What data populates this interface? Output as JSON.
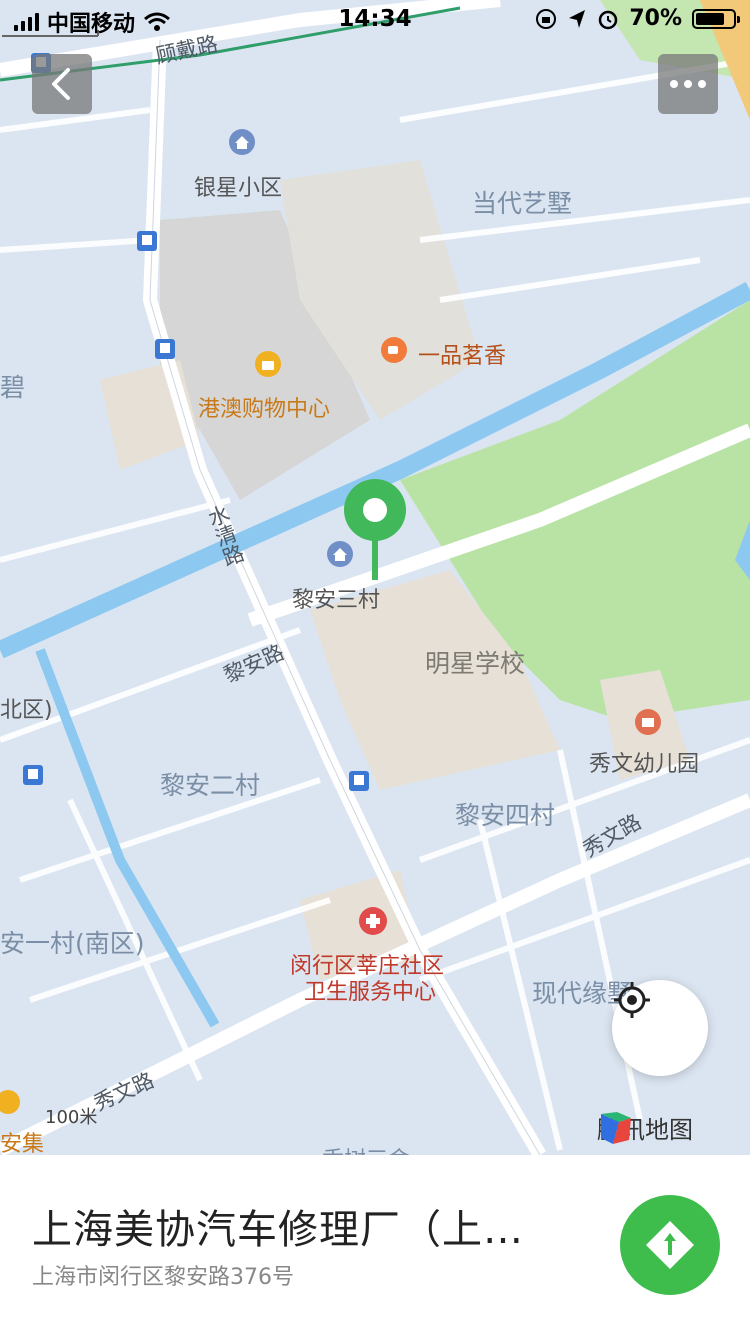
{
  "status": {
    "carrier": "中国移动",
    "time": "14:34",
    "battery": "70%",
    "battery_level": 0.7
  },
  "map": {
    "labels": {
      "gudai_road": "顾戴路",
      "yinxing": "银星小区",
      "dangdai": "当代艺墅",
      "yipin": "一品茗香",
      "gangao": "港澳购物中心",
      "shuiqing": "水清路",
      "lian3": "黎安三村",
      "lian_road": "黎安路",
      "mingxing": "明星学校",
      "bei": "北区)",
      "xiuwen_kg": "秀文幼儿园",
      "lian2": "黎安二村",
      "lian4": "黎安四村",
      "xiuwen_road_right": "秀文路",
      "lian1_south": "安一村(南区)",
      "hospital_1": "闵行区莘庄社区",
      "hospital_2": "卫生服务中心",
      "xiandai": "现代缘墅",
      "xiuwen_road_left": "秀文路",
      "anji": "安集",
      "left_edge": "碧",
      "bottom_cut": "香树三舍"
    },
    "scale_label": "100米",
    "watermark": "腾讯地图"
  },
  "place": {
    "name": "上海美协汽车修理厂（上…",
    "address": "上海市闵行区黎安路376号"
  },
  "icons": {
    "back": "chevron-left-icon",
    "more": "more-dots-icon",
    "locate": "crosshair-icon",
    "navigate": "navigation-arrow-icon",
    "pin": "map-pin-icon"
  }
}
